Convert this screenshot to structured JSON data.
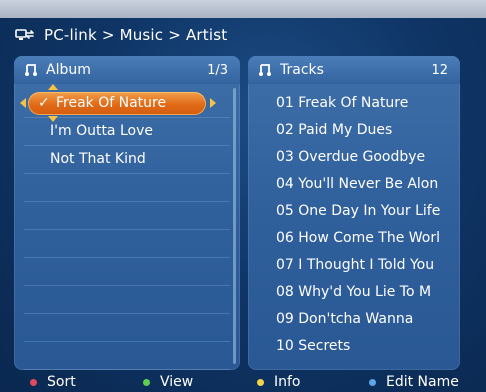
{
  "header": {
    "breadcrumb": "PC-link > Music > Artist",
    "icon": "pc-link-icon"
  },
  "album_panel": {
    "title": "Album",
    "page": "1/3",
    "items": [
      {
        "label": "Freak Of Nature",
        "selected": true
      },
      {
        "label": "I'm Outta Love"
      },
      {
        "label": "Not That Kind"
      }
    ]
  },
  "tracks_panel": {
    "title": "Tracks",
    "count": "12",
    "items": [
      "01 Freak Of Nature",
      "02 Paid My Dues",
      "03 Overdue Goodbye",
      "04 You'll Never Be Alon",
      "05 One Day In Your Life",
      "06 How Come The Worl",
      "07 I Thought I Told You",
      "08 Why'd You Lie To M",
      "09 Don'tcha Wanna",
      "10 Secrets"
    ]
  },
  "footer": {
    "sort": {
      "label": "Sort",
      "color": "#e04a5a"
    },
    "view": {
      "label": "View",
      "color": "#5fcf4f"
    },
    "info": {
      "label": "Info",
      "color": "#f2d34a"
    },
    "edit": {
      "label": "Edit Name",
      "color": "#5aa6e8"
    }
  },
  "icons": {
    "selected_mark": "✓",
    "note": "music-note-icon"
  }
}
